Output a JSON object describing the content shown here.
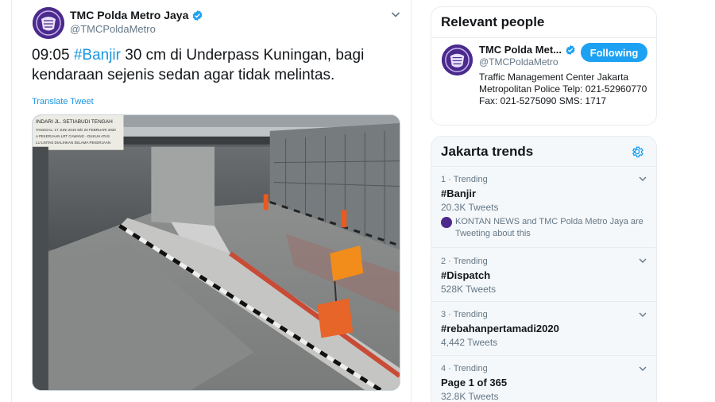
{
  "tweet": {
    "author_name": "TMC Polda Metro Jaya",
    "author_handle": "@TMCPoldaMetro",
    "text_time": "09:05 ",
    "text_hashtag": "#Banjir",
    "text_rest_line1": " 30 cm di Underpass Kuningan, bagi",
    "text_line2": "kendaraan sejenis sedan agar tidak melintas.",
    "translate_label": "Translate Tweet",
    "photo_sign_text": {
      "line1": "INDARI JL. SETIABUDI TENGAH",
      "line2": "TANGGAL: 17 JUNI 2019 S/D 20 FEBRUARI 2020",
      "line3": "A PEKERJAAN LRT CAWANG - DUKUH ATAS",
      "line4": "LU LINTAS DIALIHKAN SELAMA PEKERJAAN"
    }
  },
  "relevant_people": {
    "title": "Relevant people",
    "name": "TMC Polda Met...",
    "handle": "@TMCPoldaMetro",
    "follow_label": "Following",
    "bio": "Traffic Management Center Jakarta Metropolitan Police Telp: 021-52960770 Fax: 021-5275090 SMS: 1717"
  },
  "trends": {
    "title": "Jakarta trends",
    "items": [
      {
        "meta": "1 · Trending",
        "name": "#Banjir",
        "count": "20.3K Tweets",
        "context": "KONTAN NEWS and TMC Polda Metro Jaya are Tweeting about this"
      },
      {
        "meta": "2 · Trending",
        "name": "#Dispatch",
        "count": "528K Tweets"
      },
      {
        "meta": "3 · Trending",
        "name": "#rebahanpertamadi2020",
        "count": "4,442 Tweets"
      },
      {
        "meta": "4 · Trending",
        "name": "Page 1 of 365",
        "count": "32.8K Tweets"
      }
    ]
  },
  "colors": {
    "accent": "#1da1f2",
    "link": "#1b95e0",
    "avatar_bg": "#4b2a8c",
    "secondary_text": "#657786"
  },
  "icons": [
    "verified-badge-icon",
    "chevron-down-icon",
    "settings-gear-icon"
  ]
}
